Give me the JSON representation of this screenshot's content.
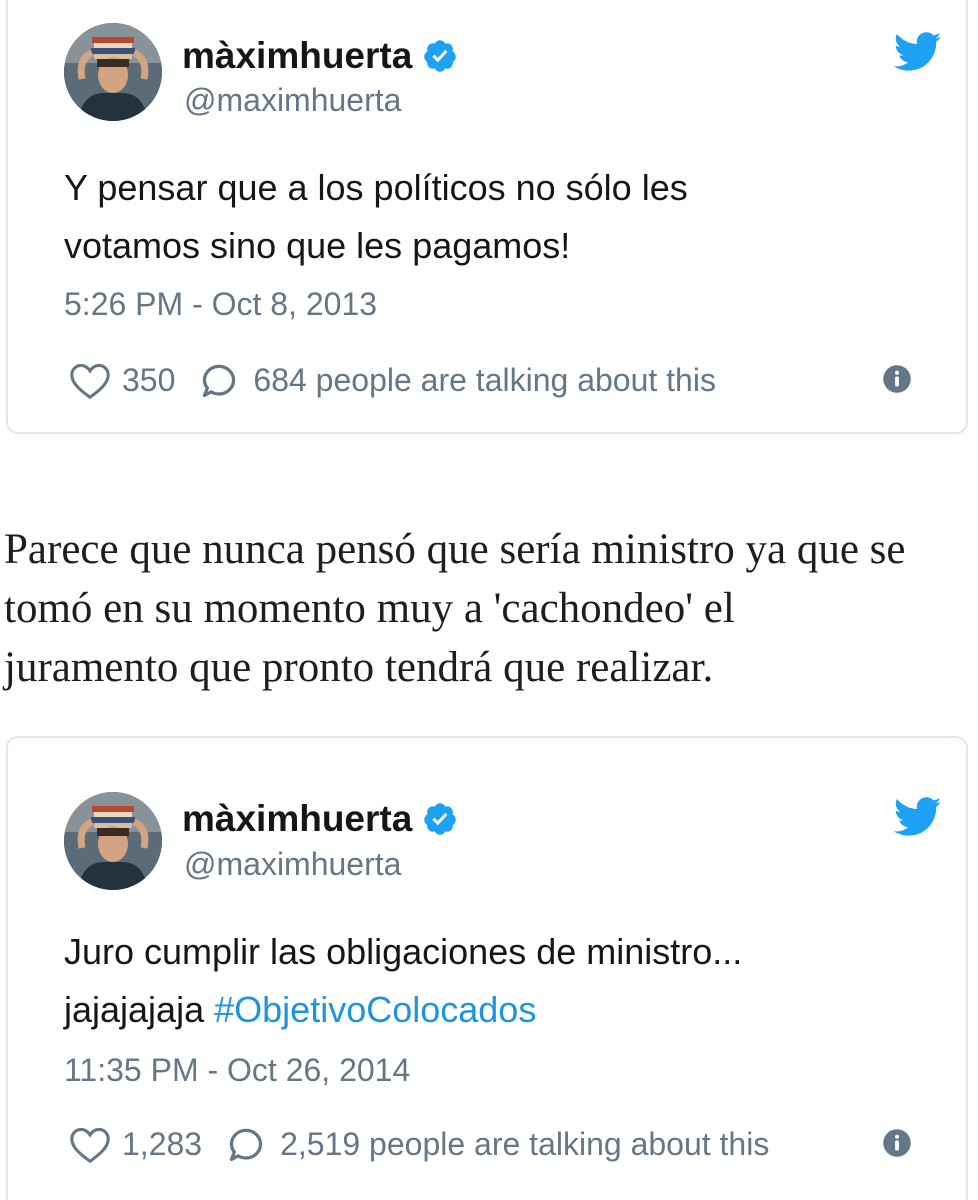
{
  "tweets": [
    {
      "display_name": "màximhuerta",
      "handle": "@maximhuerta",
      "text_lines": [
        "Y pensar que a los políticos no sólo les",
        "votamos sino que les pagamos!"
      ],
      "timestamp": "5:26 PM - Oct 8, 2013",
      "likes": "350",
      "talking": "684 people are talking about this"
    },
    {
      "display_name": "màximhuerta",
      "handle": "@maximhuerta",
      "text_line_1": "Juro cumplir las obligaciones de ministro...",
      "text_line_2_prefix": "jajajajaja",
      "hashtag": "#ObjetivoColocados",
      "timestamp": "11:35 PM - Oct 26, 2014",
      "likes": "1,283",
      "talking": "2,519 people are talking about this"
    }
  ],
  "article": {
    "lines": [
      "Parece que nunca pensó que sería ministro ya que se",
      "tomó en su momento muy a 'cachondeo' el",
      "juramento que pronto tendrá que realizar."
    ]
  },
  "colors": {
    "verified": "#1da1f2",
    "twitter_bird": "#1da1f2",
    "hashtag": "#1b95e0",
    "secondary_text": "#657786",
    "border": "#e1e8ed"
  },
  "icons": [
    "verified-badge-icon",
    "twitter-bird-icon",
    "heart-icon",
    "reply-icon",
    "info-icon"
  ]
}
